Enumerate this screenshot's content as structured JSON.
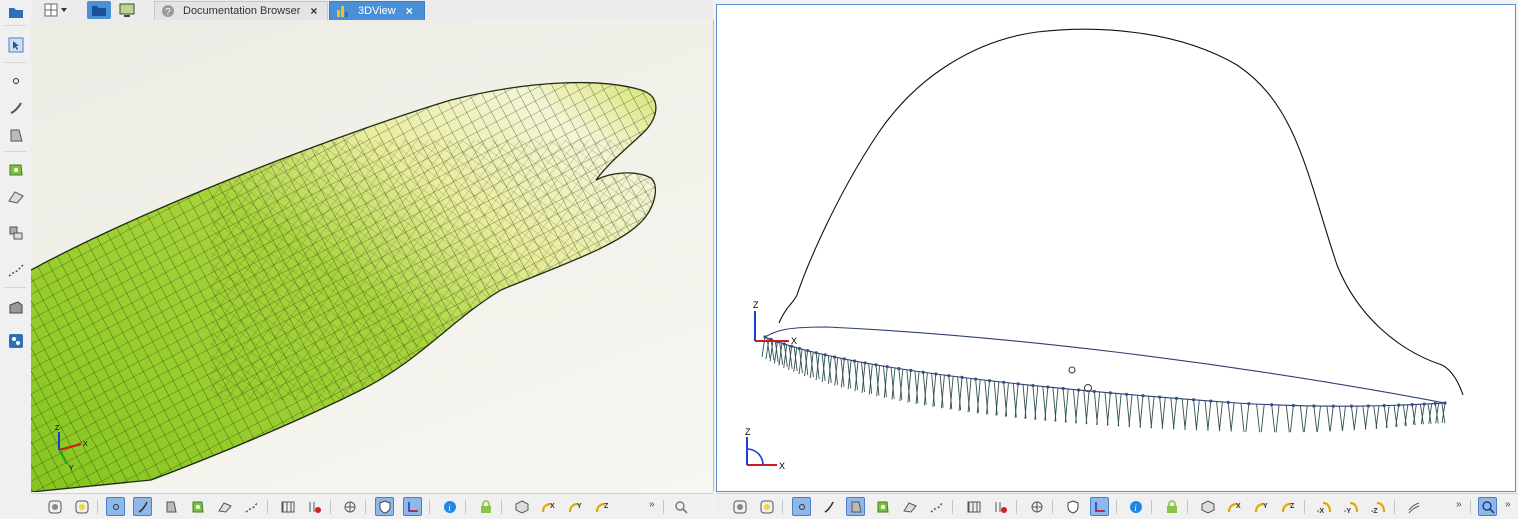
{
  "tabs": [
    {
      "label": "Documentation Browser",
      "active": false,
      "close": "×"
    },
    {
      "label": "3DView",
      "active": true,
      "close": "×"
    }
  ],
  "left_view": {
    "axis_labels": {
      "x": "X",
      "y": "Y",
      "z": "Z"
    }
  },
  "right_view": {
    "main_axis_labels": {
      "x": "X",
      "z": "Z"
    },
    "corner_axis_labels": {
      "x": "X",
      "z": "Z"
    }
  },
  "bottom_toolbar": {
    "view_x_label": "X",
    "view_y_label": "Y",
    "view_z_label": "Z",
    "view_neg_x_label": "-X",
    "view_neg_y_label": "-Y",
    "view_neg_z_label": "-Z",
    "more_label": "»"
  },
  "colors": {
    "accent": "#4a90d9",
    "hull_green": "#8ccf1e",
    "curve_dark": "#2f5050",
    "point_blue": "#3a4f8a"
  }
}
